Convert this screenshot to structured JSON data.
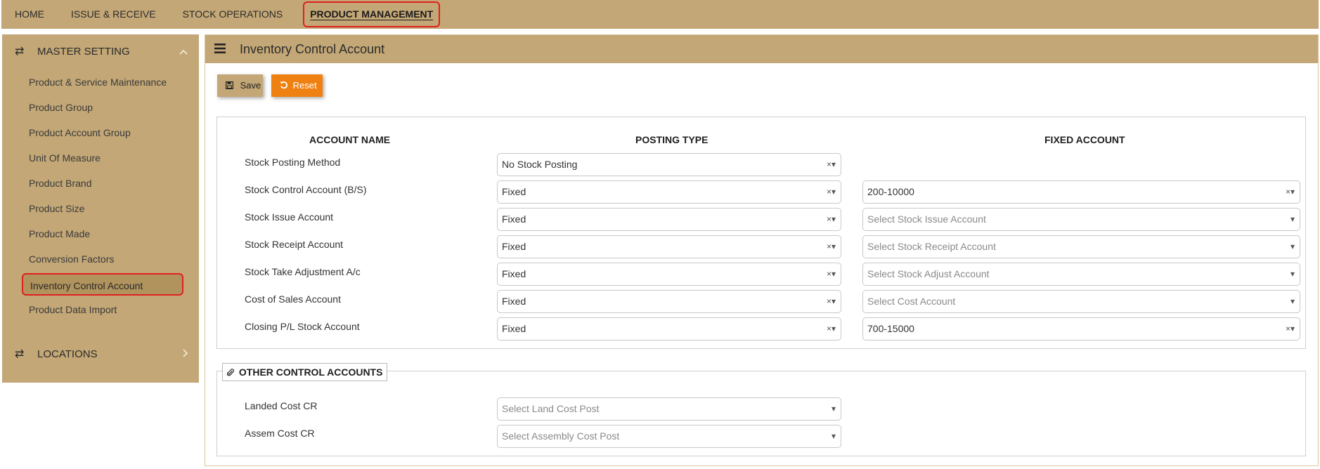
{
  "nav": {
    "items": [
      "HOME",
      "ISSUE & RECEIVE",
      "STOCK OPERATIONS"
    ],
    "active": "PRODUCT MANAGEMENT"
  },
  "sidebar": {
    "section1": {
      "icon": "transfer-arrows-icon",
      "label": "MASTER SETTING",
      "chevron": "chevron-up-icon"
    },
    "items": [
      "Product & Service Maintenance",
      "Product Group",
      "Product Account Group",
      "Unit Of Measure",
      "Product Brand",
      "Product Size",
      "Product Made",
      "Conversion Factors",
      "Inventory Control Account",
      "Product Data Import"
    ],
    "active_item": "Inventory Control Account",
    "section2": {
      "icon": "transfer-arrows-icon",
      "label": "LOCATIONS",
      "chevron": "chevron-right-icon"
    }
  },
  "main": {
    "title": "Inventory Control Account",
    "save_label": "Save",
    "reset_label": "Reset",
    "columns": {
      "account": "ACCOUNT NAME",
      "posting": "POSTING TYPE",
      "fixed": "FIXED ACCOUNT"
    },
    "rows": [
      {
        "label": "Stock Posting Method",
        "posting": "No Stock Posting",
        "fixed": null,
        "fixed_placeholder": null
      },
      {
        "label": "Stock Control Account (B/S)",
        "posting": "Fixed",
        "fixed": "200-10000",
        "fixed_placeholder": null
      },
      {
        "label": "Stock Issue Account",
        "posting": "Fixed",
        "fixed": null,
        "fixed_placeholder": "Select Stock Issue Account"
      },
      {
        "label": "Stock Receipt Account",
        "posting": "Fixed",
        "fixed": null,
        "fixed_placeholder": "Select Stock Receipt Account"
      },
      {
        "label": "Stock Take Adjustment A/c",
        "posting": "Fixed",
        "fixed": null,
        "fixed_placeholder": "Select Stock Adjust Account"
      },
      {
        "label": "Cost of Sales Account",
        "posting": "Fixed",
        "fixed": null,
        "fixed_placeholder": "Select Cost Account"
      },
      {
        "label": "Closing P/L Stock Account",
        "posting": "Fixed",
        "fixed": "700-15000",
        "fixed_placeholder": null
      }
    ],
    "other": {
      "legend": "OTHER CONTROL ACCOUNTS",
      "rows": [
        {
          "label": "Landed Cost CR",
          "placeholder": "Select Land Cost Post"
        },
        {
          "label": "Assem Cost CR",
          "placeholder": "Select Assembly Cost Post"
        }
      ]
    }
  },
  "colors": {
    "tan": "#c3a776",
    "tan_dark": "#b0935d",
    "highlight_border": "#e02020",
    "reset_orange": "#ef8112"
  }
}
